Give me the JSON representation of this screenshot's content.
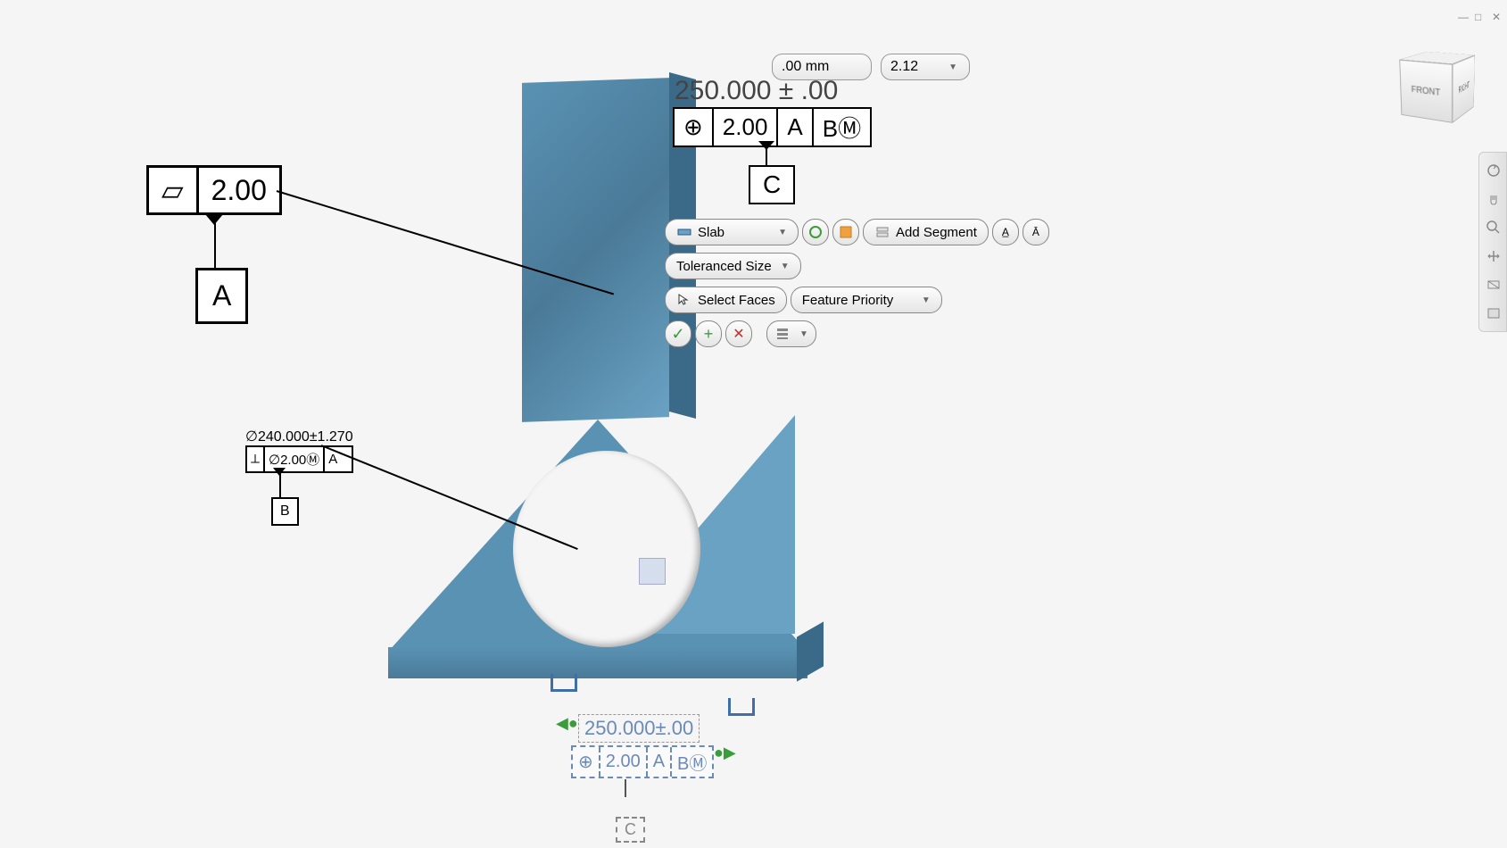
{
  "window": {
    "minimize": "—",
    "maximize": "□",
    "close": "✕"
  },
  "top_toolbar": {
    "input_value": ".00 mm",
    "dropdown_value": "2.12"
  },
  "main_dimension": "250.000 ± .00",
  "fcf_1": {
    "symbol": "⊕",
    "tolerance": "2.00",
    "datum_1": "A",
    "datum_2": "BⓂ"
  },
  "datum_c_box": "C",
  "datum_a": {
    "symbol": "▱",
    "tolerance": "2.00",
    "box": "A"
  },
  "datum_b": {
    "dimension": "∅240.000±1.270",
    "symbol": "⟂",
    "tolerance": "∅2.00Ⓜ",
    "datum": "A",
    "box": "B"
  },
  "tool_panel": {
    "feature_type": "Slab",
    "add_segment": "Add Segment",
    "tolerance_mode": "Toleranced Size",
    "select_faces": "Select Faces",
    "selection_priority": "Feature Priority"
  },
  "bottom_annotations": {
    "dimension": "250.000±.00",
    "fcf": {
      "symbol": "⊕",
      "tolerance": "2.00",
      "datum_1": "A",
      "datum_2": "BⓂ"
    },
    "datum": "C"
  },
  "view_cube": {
    "front": "FRONT",
    "right": "RIGHT",
    "top": ""
  }
}
